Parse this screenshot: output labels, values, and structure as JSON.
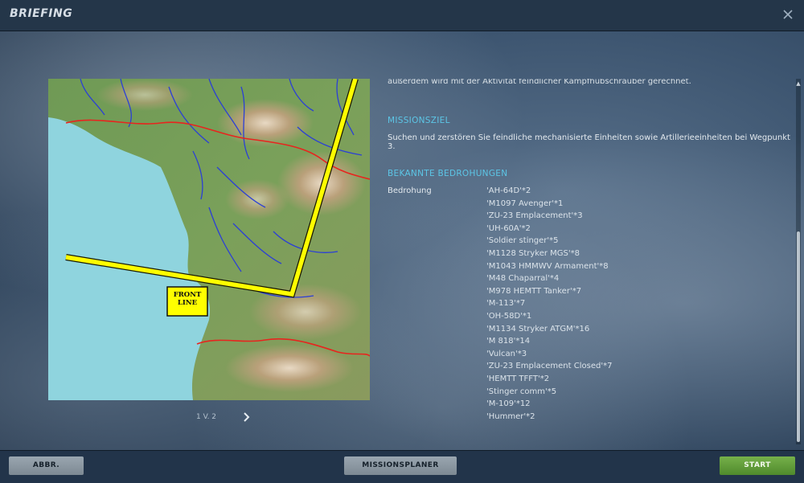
{
  "window": {
    "title": "BRIEFING",
    "close_icon": "close-icon"
  },
  "map": {
    "frontline_label_line1": "FRONT",
    "frontline_label_line2": "LINE",
    "colors": {
      "sea": "#8fd4de",
      "frontline": "#ffff00",
      "border": "#e8241e",
      "rivers": "#2b3fd6"
    }
  },
  "pager": {
    "text": "1 V. 2",
    "next_icon": "chevron-right-icon"
  },
  "briefing": {
    "intro_cut": "außerdem wird mit der Aktivität feindlicher Kampfhubschrauber gerechnet.",
    "objective_title": "MISSIONSZIEL",
    "objective_text": "Suchen und zerstören Sie feindliche mechanisierte Einheiten sowie Artillerieeinheiten bei Wegpunkt 3.",
    "threats_title": "BEKANNTE BEDROHUNGEN",
    "threat_label": "Bedrohung",
    "threats": [
      "'AH-64D'*2",
      "'M1097 Avenger'*1",
      "'ZU-23 Emplacement'*3",
      "'UH-60A'*2",
      "'Soldier stinger'*5",
      "'M1128 Stryker MGS'*8",
      "'M1043 HMMWV Armament'*8",
      "'M48 Chaparral'*4",
      "'M978 HEMTT Tanker'*7",
      "'M-113'*7",
      "'OH-58D'*1",
      "'M1134 Stryker ATGM'*16",
      "'M 818'*14",
      "'Vulcan'*3",
      "'ZU-23 Emplacement Closed'*7",
      "'HEMTT TFFT'*2",
      "'Stinger comm'*5",
      "'M-109'*12",
      "'Hummer'*2"
    ]
  },
  "footer": {
    "abort_label": "ABBR.",
    "planner_label": "MISSIONSPLANER",
    "start_label": "START"
  }
}
